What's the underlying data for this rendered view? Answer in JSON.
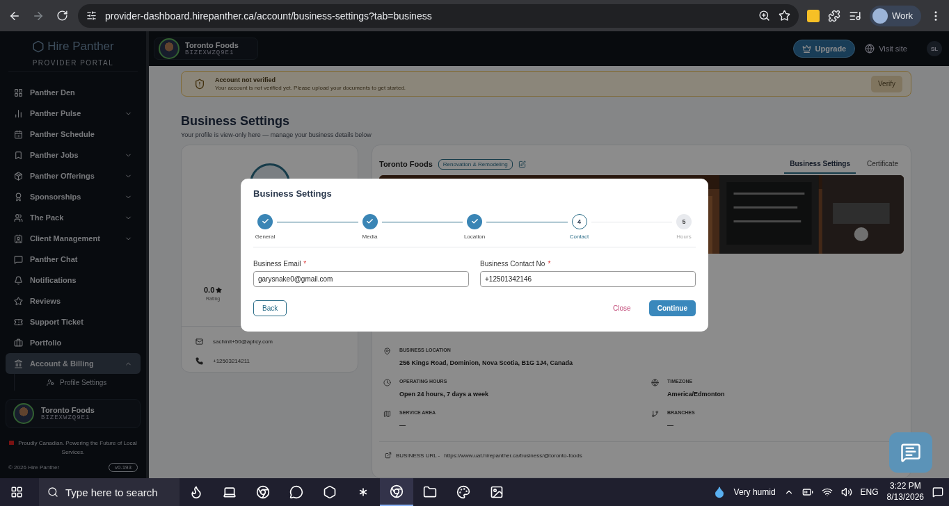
{
  "browser": {
    "url": "provider-dashboard.hirepanther.ca/account/business-settings?tab=business",
    "profile": "Work"
  },
  "sidebar": {
    "logo": "Hire Panther",
    "subtitle": "PROVIDER PORTAL",
    "items": [
      {
        "label": "Panther Den",
        "selected": false
      },
      {
        "label": "Panther Pulse",
        "selected": false,
        "expanded": false
      },
      {
        "label": "Panther Schedule",
        "selected": false
      },
      {
        "label": "Panther Jobs",
        "selected": false,
        "expanded": false
      },
      {
        "label": "Panther Offerings",
        "selected": false,
        "expanded": false
      },
      {
        "label": "Sponsorships",
        "selected": false,
        "expanded": false
      },
      {
        "label": "The Pack",
        "selected": false,
        "expanded": false
      },
      {
        "label": "Client Management",
        "selected": false,
        "expanded": false
      },
      {
        "label": "Panther Chat",
        "selected": false
      },
      {
        "label": "Notifications",
        "selected": false
      },
      {
        "label": "Reviews",
        "selected": false
      },
      {
        "label": "Support Ticket",
        "selected": false
      },
      {
        "label": "Portfolio",
        "selected": false
      },
      {
        "label": "Account & Billing",
        "selected": true,
        "expanded": true,
        "children": [
          {
            "label": "Profile Settings",
            "selected": false
          }
        ]
      }
    ],
    "user": {
      "name": "Toronto Foods",
      "id": "BIZEXWZQ9E1"
    },
    "note": "Proudly Canadian. Powering the Future of Local Services.",
    "copyright": "© 2026 Hire Panther",
    "version": "v0.193"
  },
  "header": {
    "business": {
      "name": "Toronto Foods",
      "id": "BIZEXWZQ9E1"
    },
    "upgrade": "Upgrade",
    "visit": "Visit site",
    "avatar": "SL"
  },
  "banner": {
    "title": "Account not verified",
    "message": "Your account is not verified yet. Please upload your documents to get started.",
    "button": "Verify"
  },
  "page": {
    "title": "Business Settings",
    "subtitle": "Your profile is view-only here — manage your business details below"
  },
  "profile_card": {
    "rating": "0.0",
    "rating_label": "Rating",
    "email": "sachinit+50@aplicy.com",
    "phone": "+12503214211"
  },
  "business_card": {
    "name": "Toronto Foods",
    "category": "Renovation & Remodeling",
    "tabs": [
      {
        "label": "Business Settings",
        "selected": true
      },
      {
        "label": "Certificate",
        "selected": false
      }
    ],
    "detail_rows": [
      {
        "items": [
          {
            "label": "BUSINESS LOCATION",
            "value": "256 Kings Road, Dominion, Nova Scotia, B1G 1J4, Canada"
          }
        ]
      },
      {
        "items": [
          {
            "label": "OPERATING HOURS",
            "value": "Open 24 hours, 7 days a week"
          },
          {
            "label": "TIMEZONE",
            "value": "America/Edmonton"
          }
        ]
      },
      {
        "items": [
          {
            "label": "SERVICE AREA",
            "value": "—"
          },
          {
            "label": "BRANCHES",
            "value": "—"
          }
        ]
      }
    ],
    "url": {
      "label": "BUSINESS URL -",
      "value": "https://www.uat.hirepanther.ca/business/@toronto-foods"
    }
  },
  "modal": {
    "title": "Business Settings",
    "steps": [
      {
        "label": "General",
        "completed": true,
        "selected": false
      },
      {
        "label": "Media",
        "completed": true,
        "selected": false
      },
      {
        "label": "Location",
        "completed": true,
        "selected": false
      },
      {
        "label": "Contact",
        "number": "4",
        "completed": false,
        "selected": true
      },
      {
        "label": "Hours",
        "number": "5",
        "completed": false,
        "selected": false
      }
    ],
    "required_mark": "*",
    "fields": [
      {
        "label": "Business Email",
        "required": true,
        "value": "garysnake0@gmail.com"
      },
      {
        "label": "Business Contact No",
        "required": true,
        "value": "+12501342146"
      }
    ],
    "back": "Back",
    "close": "Close",
    "continue": "Continue"
  },
  "taskbar": {
    "search": "Type here to search",
    "weather": "Very humid",
    "language": "ENG",
    "time": "3:22 PM",
    "date": "8/13/2026"
  }
}
